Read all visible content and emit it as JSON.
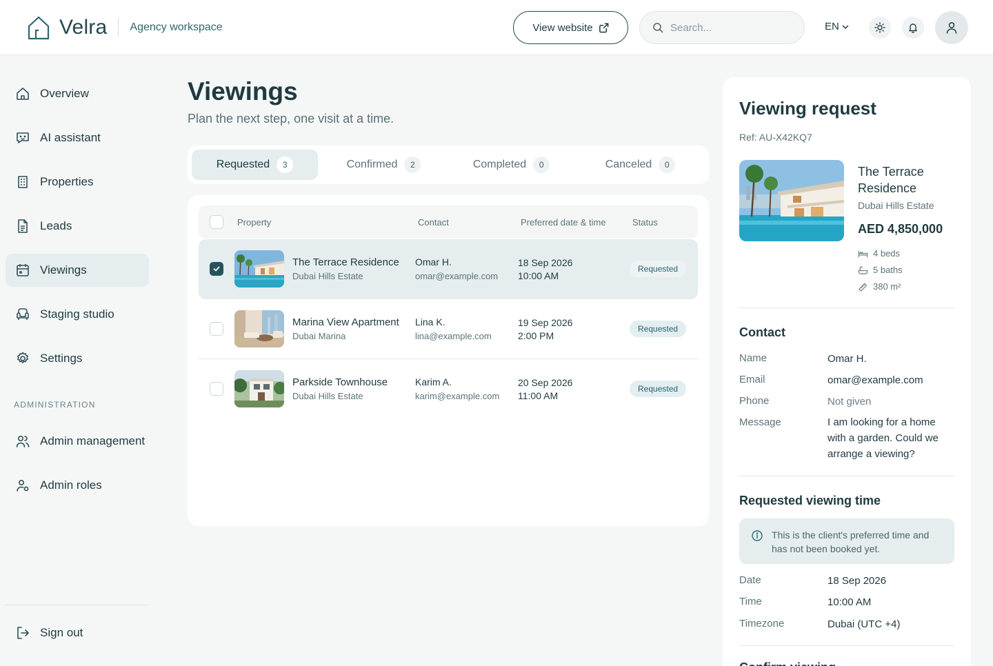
{
  "header": {
    "brand_name": "Velra",
    "workspace": "Agency workspace",
    "view_website": "View website",
    "search_placeholder": "Search...",
    "language": "EN"
  },
  "sidebar": {
    "items": [
      {
        "label": "Overview",
        "icon": "home-icon"
      },
      {
        "label": "AI assistant",
        "icon": "chat-bot-icon"
      },
      {
        "label": "Properties",
        "icon": "building-icon"
      },
      {
        "label": "Leads",
        "icon": "document-icon"
      },
      {
        "label": "Viewings",
        "icon": "calendar-icon",
        "active": true
      },
      {
        "label": "Staging studio",
        "icon": "armchair-icon"
      },
      {
        "label": "Settings",
        "icon": "gear-icon"
      }
    ],
    "section_label": "ADMINISTRATION",
    "admin_items": [
      {
        "label": "Admin management",
        "icon": "users-icon"
      },
      {
        "label": "Admin roles",
        "icon": "user-role-icon"
      }
    ],
    "sign_out": "Sign out"
  },
  "main": {
    "title": "Viewings",
    "subtitle": "Plan the next step, one visit at a time.",
    "tabs": [
      {
        "label": "Requested",
        "count": "3",
        "active": true
      },
      {
        "label": "Confirmed",
        "count": "2"
      },
      {
        "label": "Completed",
        "count": "0"
      },
      {
        "label": "Canceled",
        "count": "0"
      }
    ],
    "columns": [
      "Property",
      "Contact",
      "Preferred date & time",
      "Status"
    ],
    "rows": [
      {
        "property": "The Terrace Residence",
        "location": "Dubai Hills Estate",
        "contact": "Omar H.",
        "email": "omar@example.com",
        "date": "18 Sep 2026",
        "time": "10:00 AM",
        "status": "Requested",
        "selected": true
      },
      {
        "property": "Marina View Apartment",
        "location": "Dubai Marina",
        "contact": "Lina K.",
        "email": "lina@example.com",
        "date": "19 Sep 2026",
        "time": "2:00 PM",
        "status": "Requested"
      },
      {
        "property": "Parkside Townhouse",
        "location": "Dubai Hills Estate",
        "contact": "Karim A.",
        "email": "karim@example.com",
        "date": "20 Sep 2026",
        "time": "11:00 AM",
        "status": "Requested"
      }
    ]
  },
  "detail": {
    "title": "Viewing request",
    "ref": "Ref: AU-X42KQ7",
    "property": "The Terrace Residence",
    "location": "Dubai Hills Estate",
    "price": "AED 4,850,000",
    "features": [
      "4 beds",
      "5 baths",
      "380 m²"
    ],
    "contact_heading": "Contact",
    "contact": {
      "name_label": "Name",
      "name": "Omar H.",
      "email_label": "Email",
      "email": "omar@example.com",
      "phone_label": "Phone",
      "phone": "Not given",
      "message_label": "Message",
      "message": "I am looking for a home with a garden. Could we arrange a viewing?"
    },
    "time_heading": "Requested viewing time",
    "info_note": "This is the client's preferred time and has not been booked yet.",
    "time": {
      "date_label": "Date",
      "date": "18 Sep 2026",
      "time_label": "Time",
      "time": "10:00 AM",
      "tz_label": "Timezone",
      "tz": "Dubai (UTC +4)"
    },
    "next_heading_partial": "Confirm viewing"
  },
  "colors": {
    "accent": "#27535c",
    "selected_row": "#e5edee",
    "badge_bg": "#e2eef0",
    "background": "#f5f7f7"
  }
}
